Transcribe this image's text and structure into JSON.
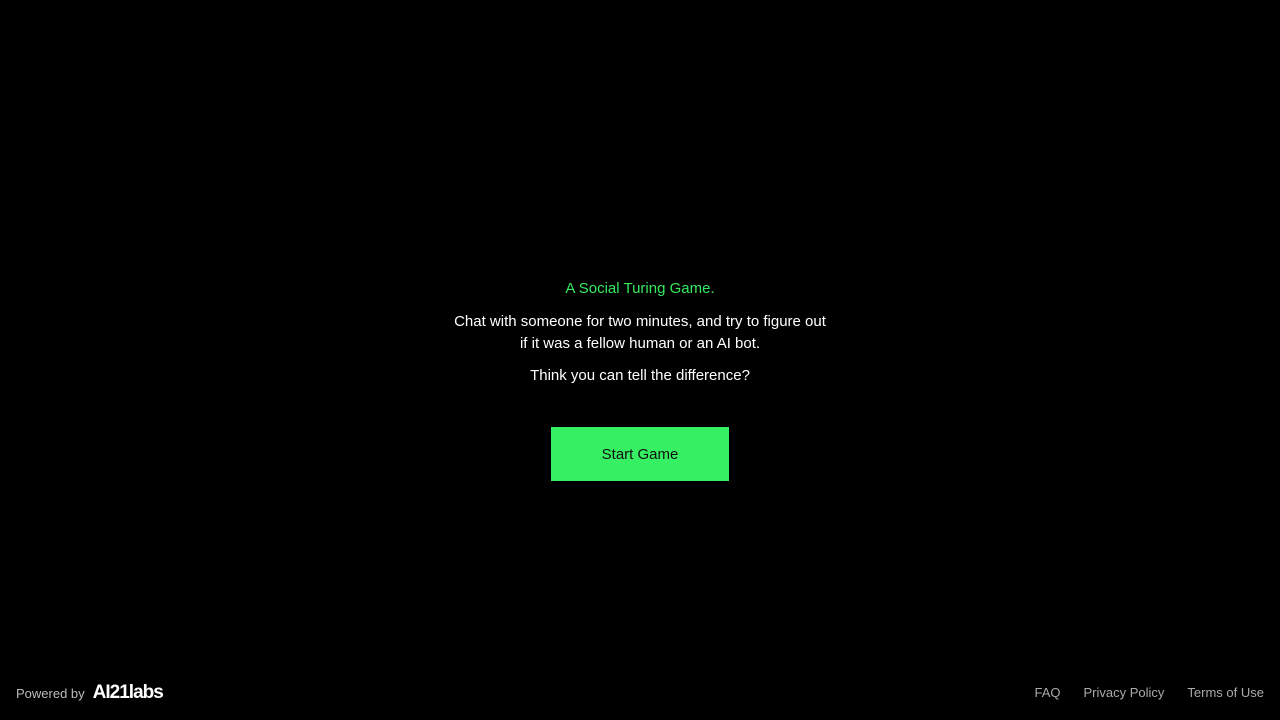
{
  "intro": {
    "tagline": "A Social Turing Game.",
    "description": "Chat with someone for two minutes, and try to figure out if it was a fellow human or an AI bot.",
    "question": "Think you can tell the difference?"
  },
  "start_button": "Start Game",
  "footer": {
    "powered_by": "Powered by",
    "logo": "AI21labs",
    "links": [
      "FAQ",
      "Privacy Policy",
      "Terms of Use"
    ]
  },
  "colors": {
    "accent": "#36ef62",
    "background": "#000000"
  }
}
